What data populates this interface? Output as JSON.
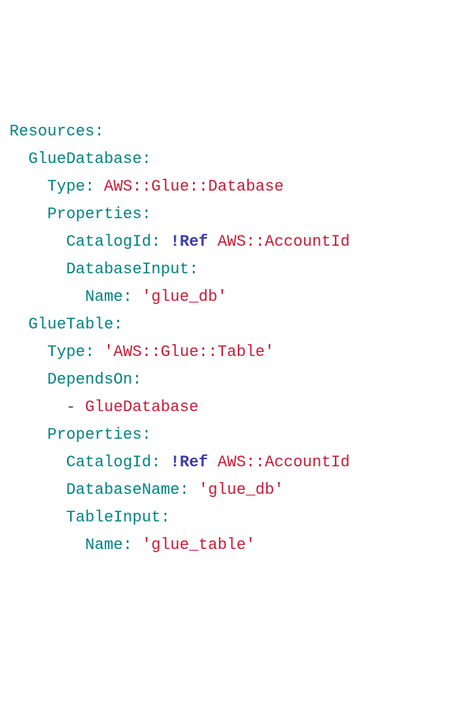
{
  "l0": {
    "key": "Resources",
    "colon": ":"
  },
  "l1": {
    "indent": "  ",
    "key": "GlueDatabase",
    "colon": ":"
  },
  "l2": {
    "indent": "    ",
    "key": "Type",
    "colon": ": ",
    "val": "AWS::Glue::Database"
  },
  "l3": {
    "indent": "    ",
    "key": "Properties",
    "colon": ":"
  },
  "l4": {
    "indent": "      ",
    "key": "CatalogId",
    "colon": ": ",
    "ref": "!Ref",
    "space": " ",
    "val": "AWS::AccountId"
  },
  "l5": {
    "indent": "      ",
    "key": "DatabaseInput",
    "colon": ":"
  },
  "l6": {
    "indent": "        ",
    "key": "Name",
    "colon": ": ",
    "val": "'glue_db'"
  },
  "l7": {
    "indent": "  ",
    "key": "GlueTable",
    "colon": ":"
  },
  "l8": {
    "indent": "    ",
    "key": "Type",
    "colon": ": ",
    "val": "'AWS::Glue::Table'"
  },
  "l9": {
    "indent": "    ",
    "key": "DependsOn",
    "colon": ":"
  },
  "l10": {
    "indent": "      ",
    "dash": "- ",
    "val": "GlueDatabase"
  },
  "l11": {
    "indent": "    ",
    "key": "Properties",
    "colon": ":"
  },
  "l12": {
    "indent": "      ",
    "key": "CatalogId",
    "colon": ": ",
    "ref": "!Ref",
    "space": " ",
    "val": "AWS::AccountId"
  },
  "l13": {
    "indent": "      ",
    "key": "DatabaseName",
    "colon": ": ",
    "val": "'glue_db'"
  },
  "l14": {
    "indent": "      ",
    "key": "TableInput",
    "colon": ":"
  },
  "l15": {
    "indent": "        ",
    "key": "Name",
    "colon": ": ",
    "val": "'glue_table'"
  }
}
